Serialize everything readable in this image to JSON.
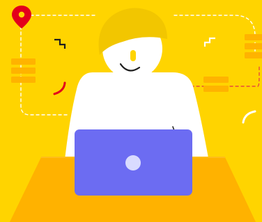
{
  "illustration": {
    "subject": "person-working-on-laptop",
    "colors": {
      "background": "#FFD400",
      "desk": "#FFB200",
      "desk_edge": "#FFBE1A",
      "person": "#FFFFFF",
      "hair": "#F2C600",
      "laptop": "#6C6CF2",
      "laptop_logo": "#D9DBFF",
      "accent_red": "#E3001B",
      "accent_orange": "#FFB300",
      "line_white": "#FFFFFF",
      "line_red": "#E84A3C",
      "outline": "#1F1F1F"
    },
    "icons": [
      "map-pin-icon",
      "zigzag-icon",
      "red-arc-icon",
      "white-arc-icon",
      "stacked-bars-icon"
    ]
  }
}
